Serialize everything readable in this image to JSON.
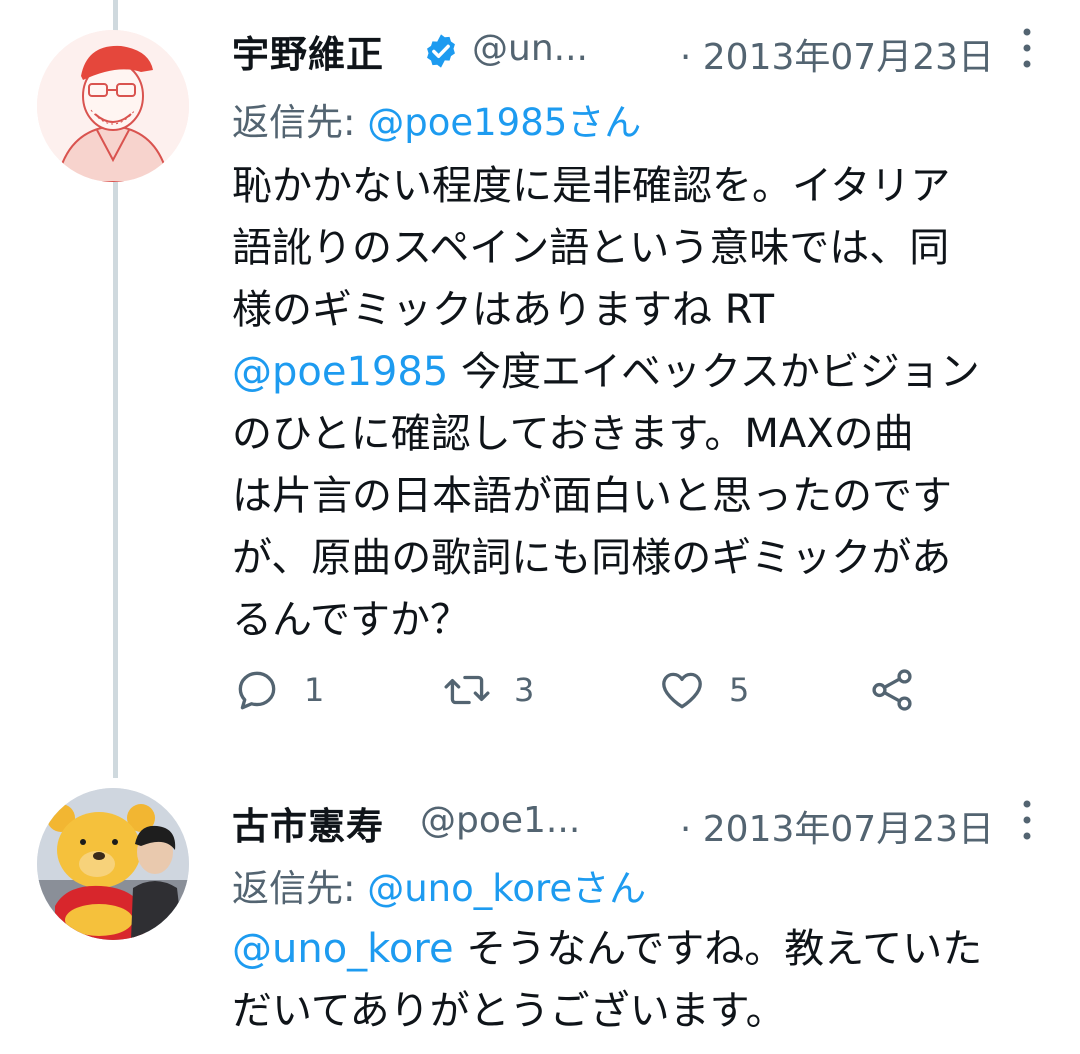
{
  "thread": [
    {
      "name": "宇野維正",
      "verified": true,
      "handle": "@un...",
      "date": "· 2013年07月23日",
      "reply_prefix": "返信先: ",
      "reply_to": "@poe1985さん",
      "body_lines": [
        {
          "text": "恥かかない程度に是非確認を。イタリア"
        },
        {
          "text": "語訛りのスペイン語という意味では、同"
        },
        {
          "text": "様のギミックはありますね RT"
        },
        {
          "mention": "@poe1985",
          "text": " 今度エイベックスかビジョン"
        },
        {
          "text": "のひとに確認しておきます。MAXの曲"
        },
        {
          "text": "は片言の日本語が面白いと思ったのです"
        },
        {
          "text": "が、原曲の歌詞にも同様のギミックがあ"
        },
        {
          "text": "るんですか？"
        }
      ],
      "actions": {
        "reply_count": "1",
        "retweet_count": "3",
        "like_count": "5"
      },
      "avatar_icon": "illustrated-man-red-cap-avatar"
    },
    {
      "name": "古市憲寿",
      "verified": false,
      "handle": "@poe1...",
      "date": "· 2013年07月23日",
      "reply_prefix": "返信先: ",
      "reply_to": "@uno_koreさん",
      "body_lines": [
        {
          "mention": "@uno_kore",
          "text": " そうなんですね。教えていた"
        },
        {
          "text": "だいてありがとうございます。"
        }
      ],
      "avatar_icon": "photo-with-pooh-avatar"
    }
  ],
  "colors": {
    "link": "#1d9bf0",
    "secondary": "#536471",
    "thread_line": "#cfd9de",
    "verified": "#1d9bf0"
  }
}
